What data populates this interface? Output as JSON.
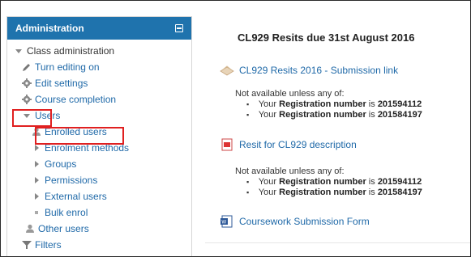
{
  "sidebar": {
    "header": "Administration",
    "section": "Class administration",
    "items": [
      {
        "label": "Turn editing on",
        "icon": "pencil-icon"
      },
      {
        "label": "Edit settings",
        "icon": "gear-icon"
      },
      {
        "label": "Course completion",
        "icon": "gear-icon"
      },
      {
        "label": "Users",
        "icon": "expanded-triangle-icon"
      },
      {
        "label": "Enrolled users",
        "icon": "user-icon"
      },
      {
        "label": "Enrolment methods",
        "icon": "collapsed-triangle-icon"
      },
      {
        "label": "Groups",
        "icon": "collapsed-triangle-icon"
      },
      {
        "label": "Permissions",
        "icon": "collapsed-triangle-icon"
      },
      {
        "label": "External users",
        "icon": "collapsed-triangle-icon"
      },
      {
        "label": "Bulk enrol",
        "icon": "bullet-icon"
      },
      {
        "label": "Other users",
        "icon": "user-icon"
      },
      {
        "label": "Filters",
        "icon": "filter-icon"
      }
    ]
  },
  "main": {
    "title": "CL929 Resits due 31st August 2016",
    "activities": [
      {
        "label": "CL929 Resits 2016 - Submission link",
        "icon": "assignment-icon"
      },
      {
        "label": "Resit for CL929 description",
        "icon": "pdf-icon"
      },
      {
        "label": "Coursework Submission Form",
        "icon": "word-document-icon"
      }
    ],
    "restrictions": [
      {
        "heading": "Not available unless any of:",
        "conditions": [
          {
            "prefix": "Your",
            "field": "Registration number",
            "is": "is",
            "value": "201594112"
          },
          {
            "prefix": "Your",
            "field": "Registration number",
            "is": "is",
            "value": "201584197"
          }
        ]
      },
      {
        "heading": "Not available unless any of:",
        "conditions": [
          {
            "prefix": "Your",
            "field": "Registration number",
            "is": "is",
            "value": "201594112"
          },
          {
            "prefix": "Your",
            "field": "Registration number",
            "is": "is",
            "value": "201584197"
          }
        ]
      }
    ]
  },
  "colors": {
    "header_bg": "#1f73ad",
    "link": "#1f69a8",
    "highlight": "#e02020"
  }
}
